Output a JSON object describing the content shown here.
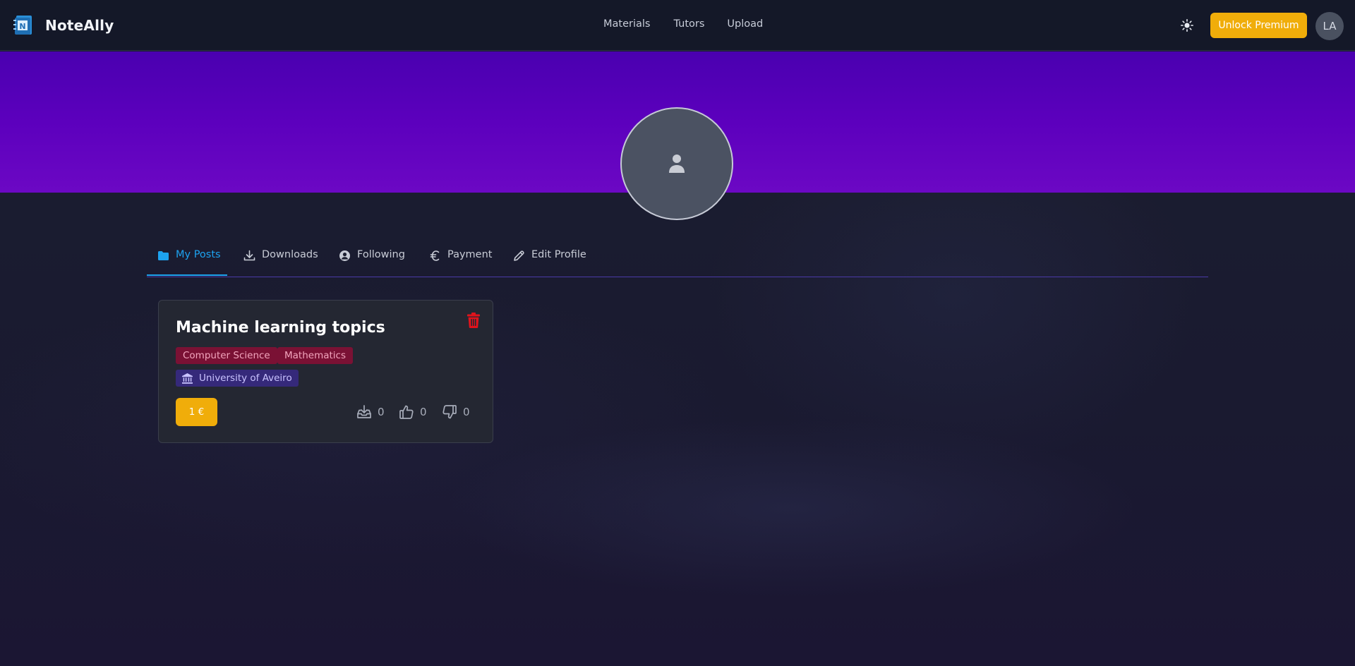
{
  "nav": {
    "brand_name": "NoteAlly",
    "links": [
      "Materials",
      "Tutors",
      "Upload"
    ],
    "premium_label": "Unlock Premium",
    "avatar_initials": "LA"
  },
  "tabs": [
    {
      "label": "My Posts",
      "icon": "folder-icon",
      "active": true
    },
    {
      "label": "Downloads",
      "icon": "download-icon",
      "active": false
    },
    {
      "label": "Following",
      "icon": "user-circle-icon",
      "active": false
    },
    {
      "label": "Payment",
      "icon": "euro-icon",
      "active": false
    },
    {
      "label": "Edit Profile",
      "icon": "pencil-icon",
      "active": false
    }
  ],
  "post": {
    "title": "Machine learning topics",
    "tags": [
      "Computer Science",
      "Mathematics"
    ],
    "university": "University of Aveiro",
    "price": "1 €",
    "downloads": "0",
    "likes": "0",
    "dislikes": "0"
  },
  "colors": {
    "accent_yellow": "#f0ad0a",
    "active_tab": "#1da3f0",
    "banner_purple": "#5c00bd",
    "tag_bg": "#7a1134",
    "university_bg": "#35297a",
    "delete_red": "#e0131c"
  }
}
